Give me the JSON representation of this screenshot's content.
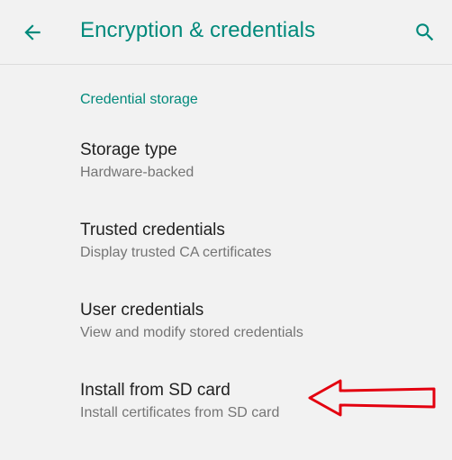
{
  "appbar": {
    "title": "Encryption & credentials",
    "back_icon": "arrow-back-icon",
    "search_icon": "search-icon",
    "accent_color": "#00897b"
  },
  "section": {
    "header": "Credential storage"
  },
  "items": [
    {
      "title": "Storage type",
      "summary": "Hardware-backed"
    },
    {
      "title": "Trusted credentials",
      "summary": "Display trusted CA certificates"
    },
    {
      "title": "User credentials",
      "summary": "View and modify stored credentials"
    },
    {
      "title": "Install from SD card",
      "summary": "Install certificates from SD card"
    }
  ],
  "annotation": {
    "icon": "red-arrow-icon",
    "color": "#e3000f"
  }
}
